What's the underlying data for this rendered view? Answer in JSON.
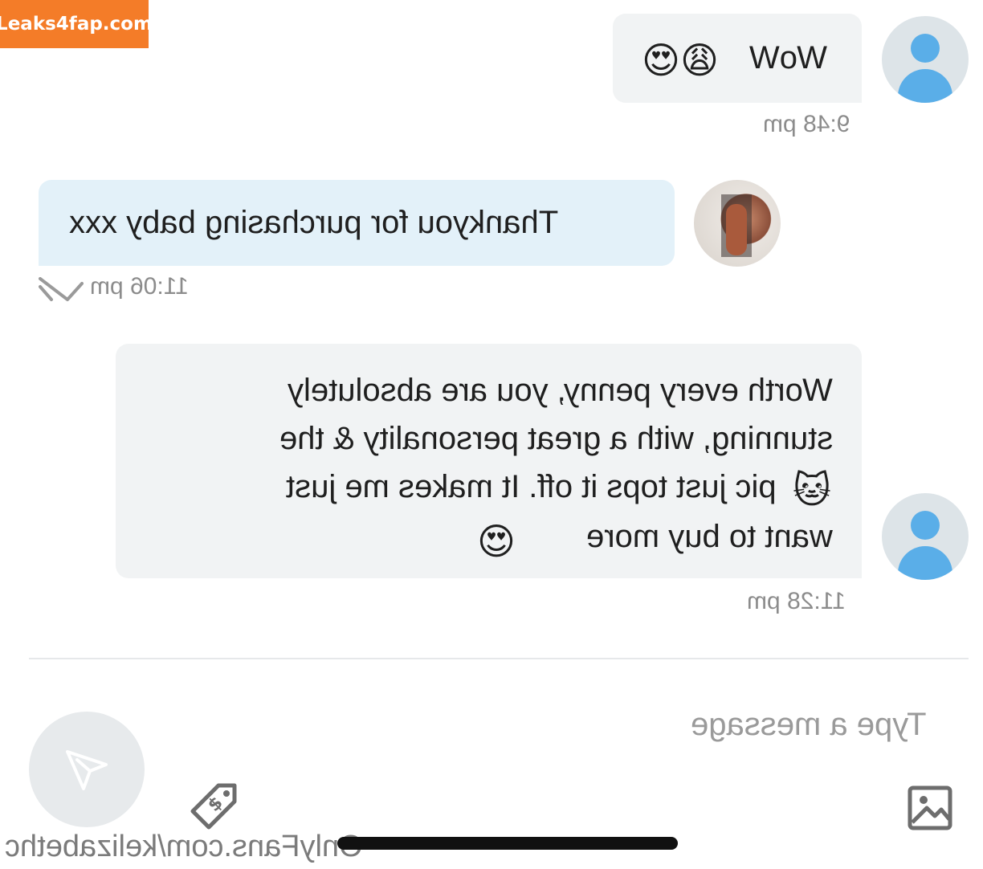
{
  "watermark": "Leaks4fap.com",
  "messages": [
    {
      "text": "WoW",
      "emoji": "😍😩",
      "time": "9:48 pm"
    },
    {
      "text": "Thankyou for purchasing baby xxx",
      "time": "11:06 pm"
    },
    {
      "lines": [
        "Worth every penny, you are absolutely",
        "stunning, with a great personality & the",
        "pic just tops it off. It makes me just",
        "want to buy more"
      ],
      "line3_emoji": "🐱",
      "line4_emoji": "😍",
      "time": "11:28 pm"
    }
  ],
  "composer": {
    "placeholder": "Type a message"
  },
  "footer": {
    "url": "OnlyFans.com/kelizabethc"
  },
  "icons": {
    "avatar_default": "user-avatar-icon",
    "send": "send-icon",
    "price_tag": "price-tag-icon",
    "image": "image-icon",
    "read_receipt": "double-check-icon"
  },
  "colors": {
    "accent": "#5aaee8",
    "incoming_bubble": "#e3f1f9",
    "outgoing_bubble": "#f1f3f4",
    "watermark_bg": "#f47c28"
  }
}
